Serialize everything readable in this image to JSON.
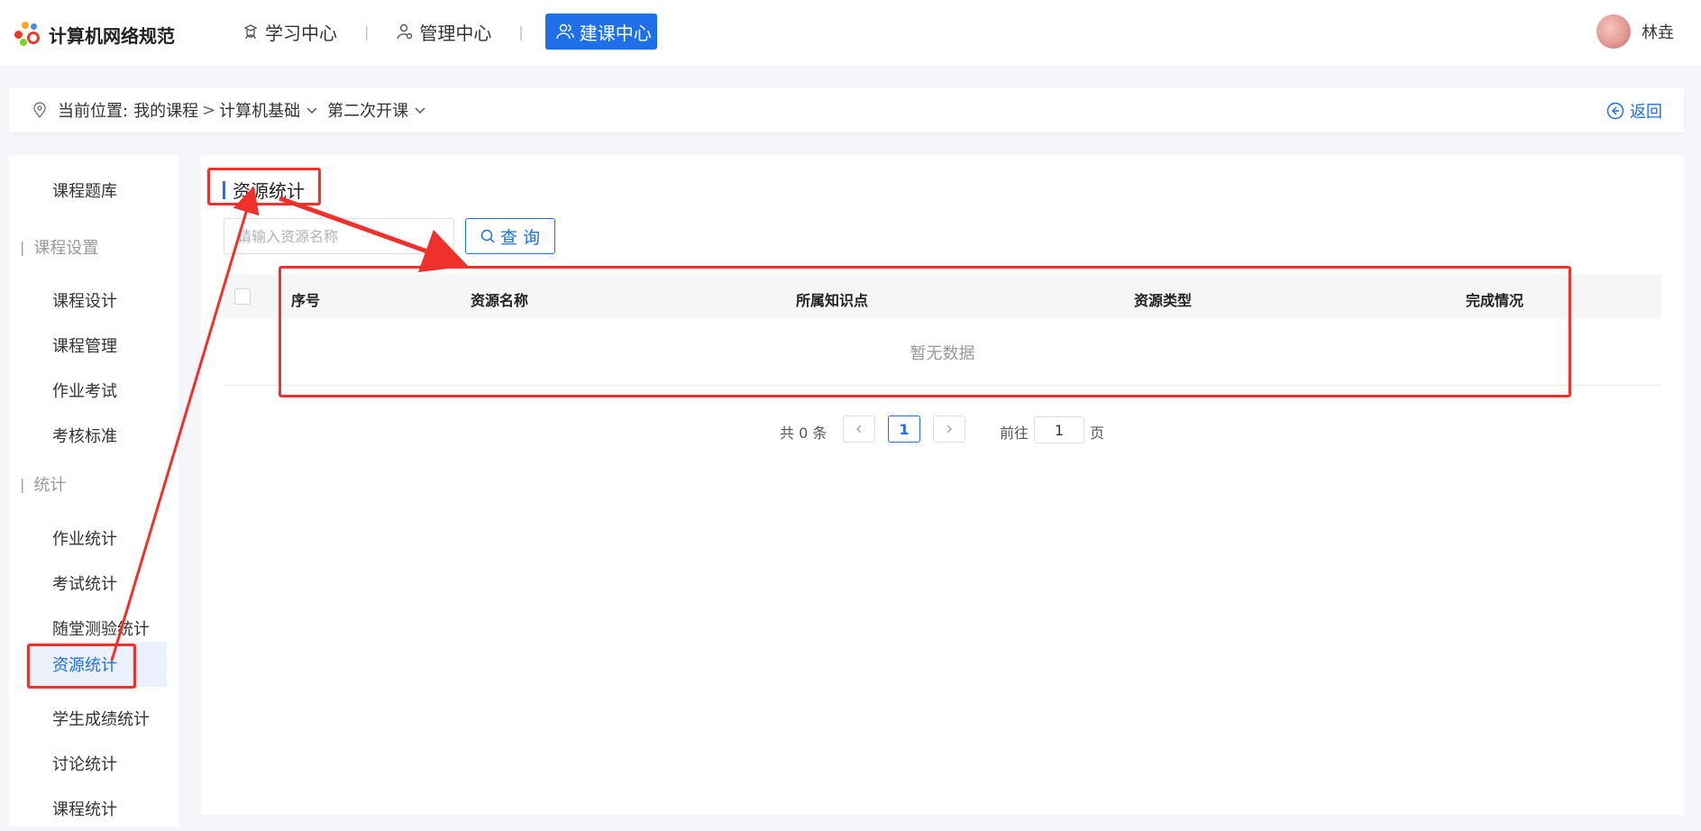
{
  "header": {
    "logo_text": "计算机网络规范",
    "nav": [
      {
        "label": "学习中心",
        "icon": "graduate-icon",
        "active": false
      },
      {
        "label": "管理中心",
        "icon": "user-gear-icon",
        "active": false
      },
      {
        "label": "建课中心",
        "icon": "users-icon",
        "active": true
      }
    ],
    "nav_separator": "|",
    "user_name": "林垚"
  },
  "breadcrumb": {
    "label": "当前位置:",
    "items": [
      "我的课程",
      "计算机基础",
      "第二次开课"
    ],
    "separator": ">",
    "back_label": "返回"
  },
  "sidebar": {
    "top_item": "课程题库",
    "groups": [
      {
        "title": "课程设置",
        "items": [
          "课程设计",
          "课程管理",
          "作业考试",
          "考核标准"
        ]
      },
      {
        "title": "统计",
        "items": [
          "作业统计",
          "考试统计",
          "随堂测验统计",
          "资源统计",
          "学生成绩统计",
          "讨论统计",
          "课程统计"
        ]
      }
    ],
    "active_item": "资源统计"
  },
  "main": {
    "section_title": "资源统计",
    "search_placeholder": "请输入资源名称",
    "search_button": "查 询",
    "table": {
      "columns": [
        "序号",
        "资源名称",
        "所属知识点",
        "资源类型",
        "完成情况"
      ],
      "empty_text": "暂无数据"
    },
    "pagination": {
      "total_text": "共 0 条",
      "current_page": "1",
      "goto_label": "前往",
      "goto_value": "1",
      "page_suffix": "页"
    }
  },
  "annotation_color": "#f0302a",
  "accent_color": "#1e6fe8"
}
